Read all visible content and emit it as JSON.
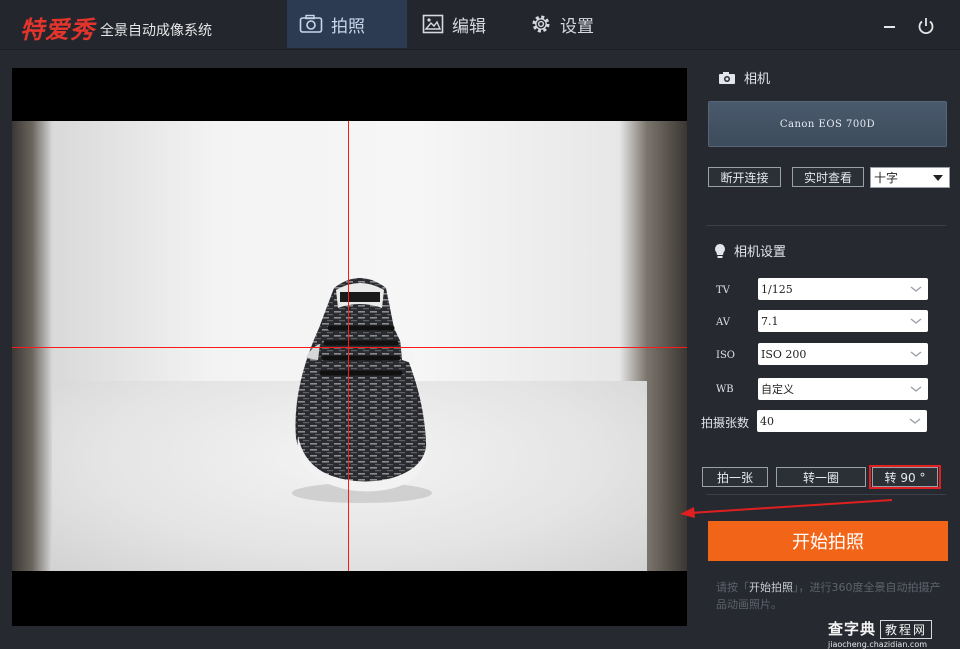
{
  "app": {
    "brand": "特爱秀",
    "subtitle": "全景自动成像系统",
    "accent": "#f26418",
    "brand_color": "#e4342b"
  },
  "tabs": [
    {
      "label": "拍照",
      "icon": "camera-icon",
      "active": true
    },
    {
      "label": "编辑",
      "icon": "image-edit-icon",
      "active": false
    },
    {
      "label": "设置",
      "icon": "gear-icon",
      "active": false
    }
  ],
  "window_controls": {
    "minimize_icon": "minimize-icon",
    "power_icon": "power-icon"
  },
  "camera_section": {
    "title": "相机",
    "camera_name": "Canon EOS 700D",
    "disconnect_label": "断开连接",
    "live_view_label": "实时查看",
    "overlay_select": "十字"
  },
  "settings_section": {
    "title": "相机设置",
    "rows": [
      {
        "label": "TV",
        "value": "1/125"
      },
      {
        "label": "AV",
        "value": "7.1"
      },
      {
        "label": "ISO",
        "value": "ISO 200"
      },
      {
        "label": "WB",
        "value": "自定义"
      },
      {
        "label": "拍摄张数",
        "value": "40"
      }
    ]
  },
  "actions": {
    "shoot_one": "拍一张",
    "rotate_circle": "转一圈",
    "rotate_90": "转 90 °"
  },
  "start_button": "开始拍照",
  "hint": {
    "prefix": "请按「",
    "highlight": "开始拍照",
    "suffix": "」，进行360度全景自动拍摄产品动画照片。"
  },
  "watermark": {
    "brand": "查字典",
    "tag": "教程网",
    "url": "jiaocheng.chazidian.com"
  }
}
